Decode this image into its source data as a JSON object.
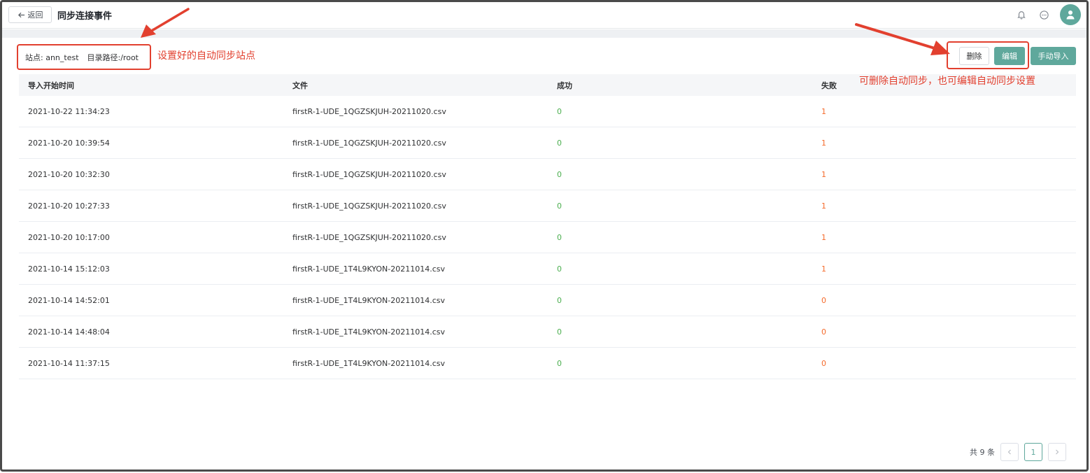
{
  "header": {
    "back_label": "返回",
    "title": "同步连接事件"
  },
  "site_info": {
    "site": "站点: ann_test",
    "path": "目录路径:/root"
  },
  "annotations": {
    "left": "设置好的自动同步站点",
    "right": "可删除自动同步，也可编辑自动同步设置"
  },
  "actions": {
    "delete": "删除",
    "edit": "编辑",
    "manual_import": "手动导入"
  },
  "table": {
    "columns": [
      "导入开始时间",
      "文件",
      "成功",
      "失败"
    ],
    "rows": [
      {
        "time": "2021-10-22 11:34:23",
        "file": "firstR-1-UDE_1QGZSKJUH-20211020.csv",
        "success": "0",
        "fail": "1"
      },
      {
        "time": "2021-10-20 10:39:54",
        "file": "firstR-1-UDE_1QGZSKJUH-20211020.csv",
        "success": "0",
        "fail": "1"
      },
      {
        "time": "2021-10-20 10:32:30",
        "file": "firstR-1-UDE_1QGZSKJUH-20211020.csv",
        "success": "0",
        "fail": "1"
      },
      {
        "time": "2021-10-20 10:27:33",
        "file": "firstR-1-UDE_1QGZSKJUH-20211020.csv",
        "success": "0",
        "fail": "1"
      },
      {
        "time": "2021-10-20 10:17:00",
        "file": "firstR-1-UDE_1QGZSKJUH-20211020.csv",
        "success": "0",
        "fail": "1"
      },
      {
        "time": "2021-10-14 15:12:03",
        "file": "firstR-1-UDE_1T4L9KYON-20211014.csv",
        "success": "0",
        "fail": "1"
      },
      {
        "time": "2021-10-14 14:52:01",
        "file": "firstR-1-UDE_1T4L9KYON-20211014.csv",
        "success": "0",
        "fail": "0"
      },
      {
        "time": "2021-10-14 14:48:04",
        "file": "firstR-1-UDE_1T4L9KYON-20211014.csv",
        "success": "0",
        "fail": "0"
      },
      {
        "time": "2021-10-14 11:37:15",
        "file": "firstR-1-UDE_1T4L9KYON-20211014.csv",
        "success": "0",
        "fail": "0"
      }
    ]
  },
  "pagination": {
    "total": "共 9 条",
    "current_page": "1",
    "prev": "<",
    "next": ">"
  },
  "colors": {
    "accent": "#5fa89c",
    "annotation": "#e2402f",
    "success": "#4caf50",
    "fail": "#f56c2d"
  }
}
